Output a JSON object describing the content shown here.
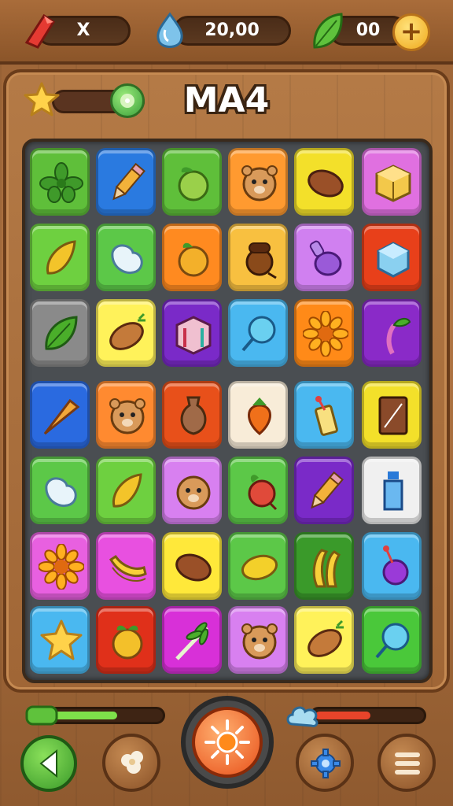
{
  "resources": {
    "gem_value": "X",
    "drop_value": "20,00",
    "leaf_value": "00",
    "add_icon": "plus-icon"
  },
  "level": {
    "title": "MA4"
  },
  "progress": {
    "star_meter": 0.0,
    "green_meter": 0.6,
    "red_meter": 0.52
  },
  "board": {
    "rows": 7,
    "cols": 6,
    "tiles": [
      [
        "leaf-cluster",
        "pencil",
        "lime",
        "hamster",
        "bean",
        "cube"
      ],
      [
        "mango",
        "bean-white",
        "orange",
        "acorn",
        "potion",
        "ice-cube"
      ],
      [
        "leaf",
        "sweet-potato",
        "crate",
        "lollipop",
        "sunflower",
        "sprout"
      ],
      [
        "carrot",
        "hamster",
        "vase",
        "strawberry",
        "drink",
        "card"
      ],
      [
        "bean-white",
        "mango",
        "hamster",
        "berry",
        "pencil",
        "bottle"
      ],
      [
        "sunflower",
        "banana",
        "bean",
        "mango",
        "banana",
        "potion"
      ],
      [
        "star",
        "orange",
        "leaf-sprig",
        "hamster",
        "sweet-potato",
        "lollipop"
      ]
    ]
  },
  "colors": {
    "accent": "#f0a91c",
    "wood": "#a06636",
    "board": "#4a4e52"
  }
}
